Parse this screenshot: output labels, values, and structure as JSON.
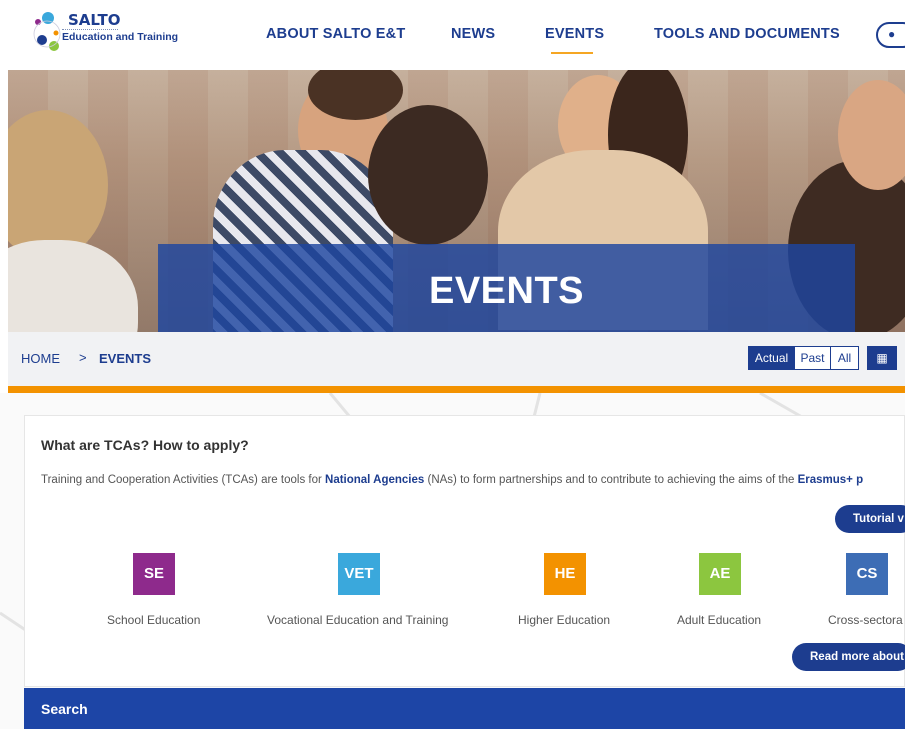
{
  "logo": {
    "name": "SALTO",
    "subtitle": "Education and Training"
  },
  "nav": {
    "items": [
      "ABOUT SALTO E&T",
      "NEWS",
      "EVENTS",
      "TOOLS AND DOCUMENTS"
    ],
    "active": "EVENTS",
    "user_icon": "user-icon"
  },
  "hero": {
    "title": "EVENTS"
  },
  "breadcrumb": {
    "home": "HOME",
    "separator": ">",
    "current": "EVENTS"
  },
  "filters": {
    "actual": "Actual",
    "past": "Past",
    "all": "All",
    "active": "Actual",
    "grid_icon": "grid-icon"
  },
  "tca": {
    "title": "What are TCAs? How to apply?",
    "text_pre": "Training and Cooperation Activities (TCAs) are tools for ",
    "link_agencies": "National Agencies",
    "text_mid": " (NAs) to form partnerships and to contribute to achieving the aims of the ",
    "link_erasmus": "Erasmus+ p",
    "tutorial_button": "Tutorial v",
    "read_more_button": "Read more about",
    "sectors": [
      {
        "code": "SE",
        "label": "School Education",
        "color": "#8e2a8c"
      },
      {
        "code": "VET",
        "label": "Vocational Education and Training",
        "color": "#3aa8dc"
      },
      {
        "code": "HE",
        "label": "Higher Education",
        "color": "#f39200"
      },
      {
        "code": "AE",
        "label": "Adult Education",
        "color": "#8cc63f"
      },
      {
        "code": "CS",
        "label": "Cross-sectora",
        "color": "#3d6db5"
      }
    ]
  },
  "search": {
    "title": "Search"
  },
  "colors": {
    "brand_blue": "#1d3d8f",
    "accent_orange": "#f39200",
    "search_blue": "#1d45a6"
  }
}
